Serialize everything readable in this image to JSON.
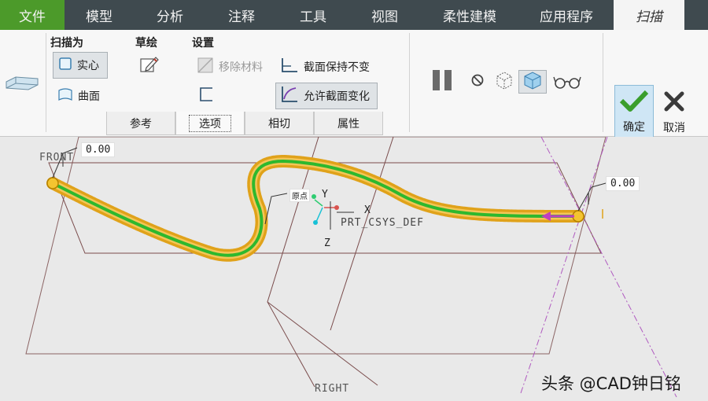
{
  "menubar": {
    "file": "文件",
    "items": [
      "模型",
      "分析",
      "注释",
      "工具",
      "视图",
      "柔性建模",
      "应用程序"
    ],
    "active": "扫描"
  },
  "ribbon": {
    "sweep_as": {
      "label": "扫描为",
      "solid": "实心",
      "surface": "曲面"
    },
    "sketch": {
      "label": "草绘"
    },
    "settings": {
      "label": "设置",
      "remove_material": "移除材料",
      "keep_section": "截面保持不变",
      "allow_section_change": "允许截面变化"
    },
    "tabs": [
      "参考",
      "选项",
      "相切",
      "属性"
    ],
    "confirm": "确定",
    "cancel": "取消"
  },
  "canvas": {
    "dim_top_left": "0.00",
    "dim_right": "0.00",
    "front_label": "FRONT",
    "right_label": "RIGHT",
    "csys_label": "PRT_CSYS_DEF",
    "axis_x": "X",
    "axis_y": "Y",
    "axis_z": "Z",
    "start_label": "原点"
  },
  "watermark": "头条 @CAD钟日铭",
  "colors": {
    "menubar": "#3f4a4f",
    "file_tab": "#4c9a2a",
    "trajectory": "#2eb82e",
    "sweep_outline": "#e0a21a",
    "datum": "#7a4c4c",
    "arrow": "#c040c0"
  }
}
